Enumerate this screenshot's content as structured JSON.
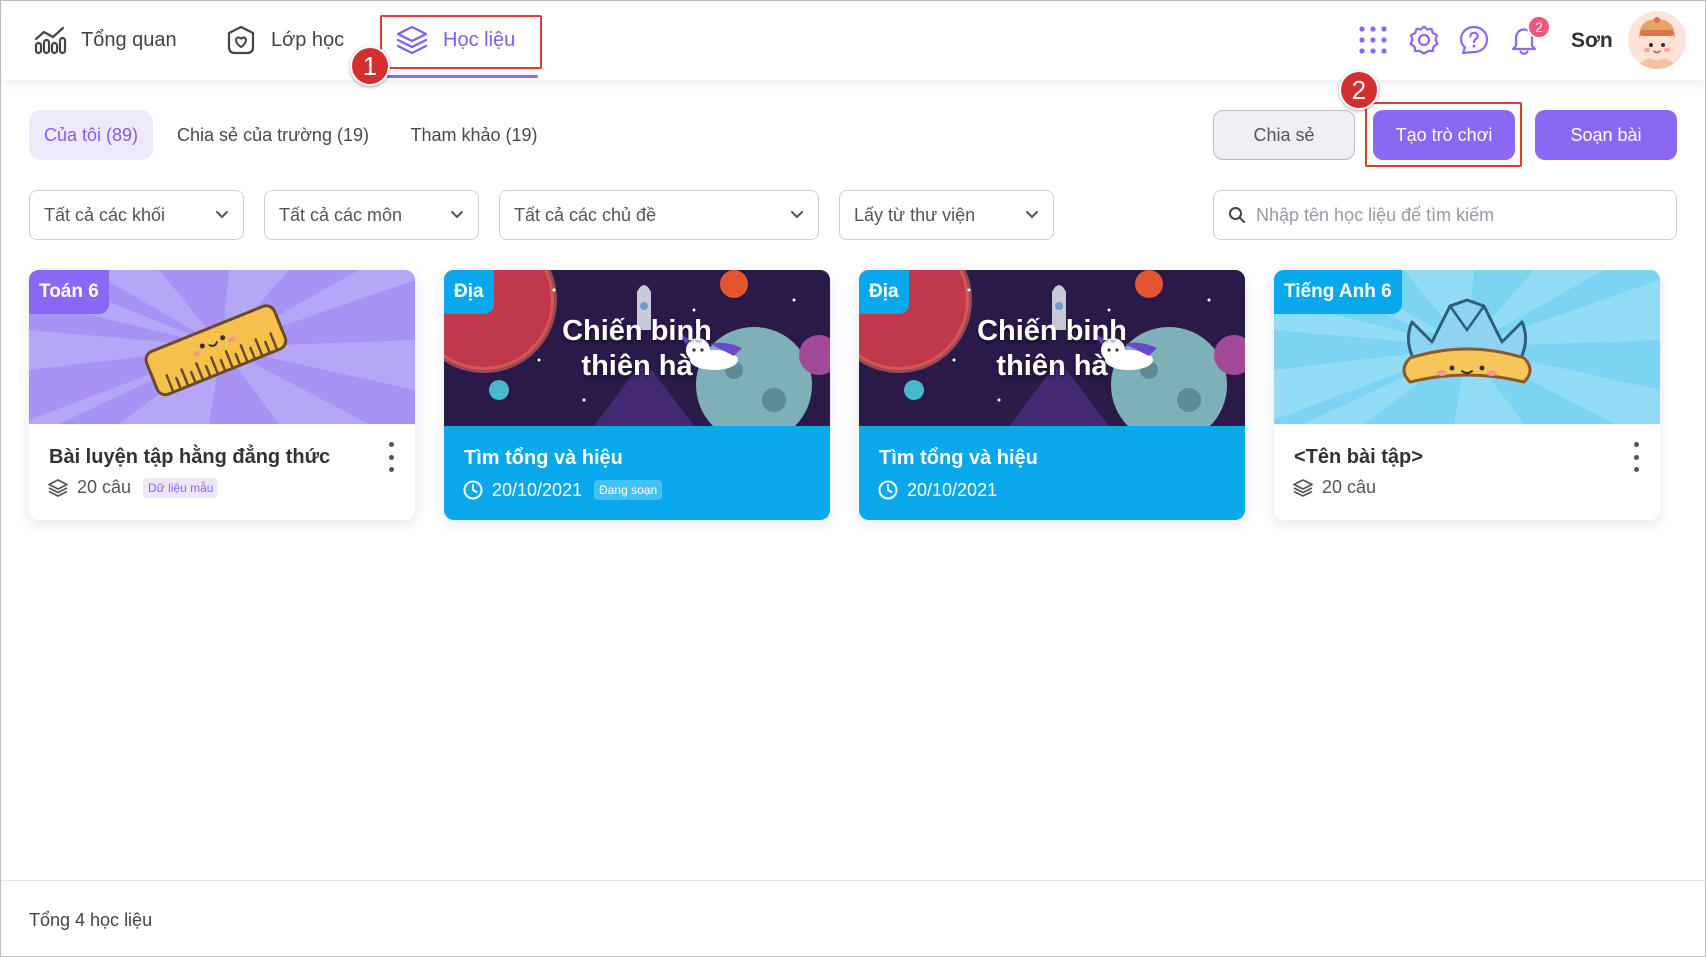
{
  "nav": {
    "items": [
      {
        "label": "Tổng quan",
        "icon": "chart-icon"
      },
      {
        "label": "Lớp học",
        "icon": "class-heart-icon"
      },
      {
        "label": "Học liệu",
        "icon": "layers-icon",
        "active": true
      }
    ]
  },
  "header": {
    "icons": [
      "apps-grid-icon",
      "settings-icon",
      "help-icon",
      "bell-icon"
    ],
    "notification_count": "2",
    "user_name": "Sơn"
  },
  "annotations": {
    "step1": "1",
    "step2": "2"
  },
  "tabs": [
    {
      "label": "Của tôi (89)",
      "active": true
    },
    {
      "label": "Chia sẻ của trường (19)"
    },
    {
      "label": "Tham khảo (19)"
    }
  ],
  "actions": {
    "share": "Chia sẻ",
    "create_game": "Tạo trò chơi",
    "compose": "Soạn bài"
  },
  "filters": [
    {
      "value": "Tất cả các khối"
    },
    {
      "value": "Tất cả các môn"
    },
    {
      "value": "Tất cả các chủ đề"
    },
    {
      "value": "Lấy từ thư viện"
    }
  ],
  "search": {
    "placeholder": "Nhập tên học liệu để tìm kiếm"
  },
  "cards": [
    {
      "tag": "Toán 6",
      "title": "Bài luyện tập hằng đẳng thức",
      "count": "20 câu",
      "badge": "Dữ liệu mẫu"
    },
    {
      "tag": "Địa",
      "thumb_title_line1": "Chiến binh",
      "thumb_title_line2": "thiên hà",
      "title": "Tìm tổng và hiệu",
      "date": "20/10/2021",
      "badge": "Đang soạn"
    },
    {
      "tag": "Địa",
      "thumb_title_line1": "Chiến binh",
      "thumb_title_line2": "thiên hà",
      "title": "Tìm tổng và hiệu",
      "date": "20/10/2021"
    },
    {
      "tag": "Tiếng Anh 6",
      "title": "<Tên bài tập>",
      "count": "20 câu"
    }
  ],
  "footer": {
    "total": "Tổng 4 học liệu"
  },
  "colors": {
    "accent": "#8a68f3",
    "tab_active_bg": "#efe9fe",
    "card_blue": "#07a9ec",
    "annotation_red": "#d32f2f"
  }
}
